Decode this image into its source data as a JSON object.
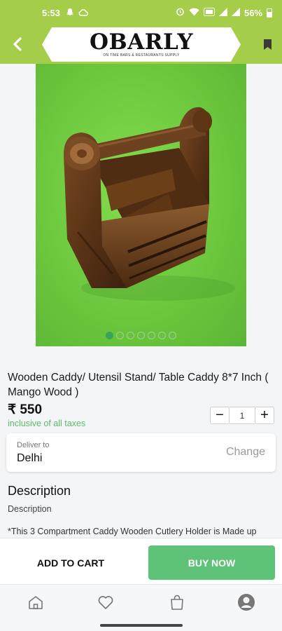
{
  "status_bar": {
    "time": "5:53",
    "battery": "56%"
  },
  "header": {
    "brand": "OBARLY",
    "tagline": "ON TIME BARS & RESTAURANTS SUPPLY"
  },
  "gallery": {
    "image_count": 7,
    "active_index": 0
  },
  "product": {
    "title": "Wooden Caddy/ Utensil Stand/ Table Caddy 8*7 Inch ( Mango Wood )",
    "price": "₹ 550",
    "tax_note": "inclusive of all taxes",
    "quantity": "1",
    "qty_minus": "−",
    "qty_plus": "+"
  },
  "delivery": {
    "label": "Deliver to",
    "city": "Delhi",
    "change_label": "Change"
  },
  "description": {
    "heading": "Description",
    "subheading": "Description",
    "text": "*This 3 Compartment Caddy Wooden Cutlery Holder is Made up"
  },
  "actions": {
    "add_to_cart": "ADD TO CART",
    "buy_now": "BUY NOW"
  },
  "colors": {
    "brand_green": "#a4cd4a",
    "buy_green": "#5ec279",
    "tax_green": "#5bbb69"
  },
  "nav": [
    "home-icon",
    "heart-icon",
    "bag-icon",
    "account-icon"
  ]
}
